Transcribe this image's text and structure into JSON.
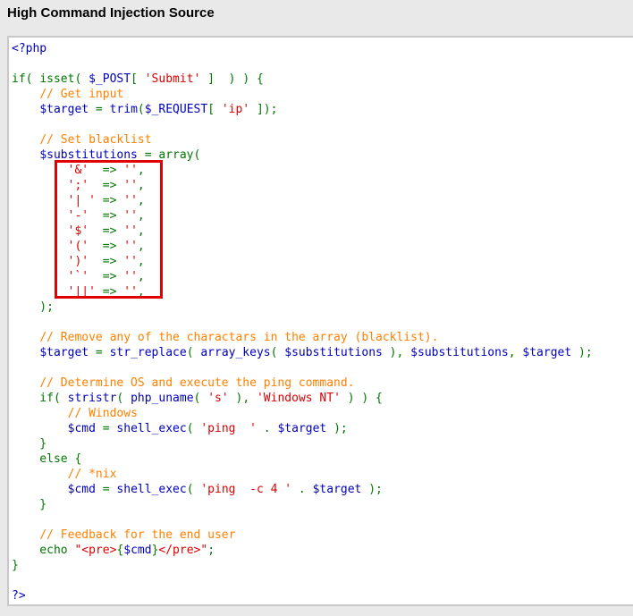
{
  "page": {
    "title": "High Command Injection Source"
  },
  "colors": {
    "keyword": "#007700",
    "variable": "#0000bb",
    "string": "#dd0000",
    "comment": "#ff8000",
    "plain": "#000000",
    "highlight_border": "#e00000",
    "panel_background": "#ffffff",
    "page_background": "#e9e9e9"
  },
  "source": {
    "lines": [
      [
        {
          "t": "<?php",
          "c": "vr"
        }
      ],
      [],
      [
        {
          "t": "if( ",
          "c": "kw"
        },
        {
          "t": "isset",
          "c": "kw"
        },
        {
          "t": "( ",
          "c": "kw"
        },
        {
          "t": "$_POST",
          "c": "vr"
        },
        {
          "t": "[ ",
          "c": "kw"
        },
        {
          "t": "'Submit'",
          "c": "st"
        },
        {
          "t": " ]  ) ) {",
          "c": "kw"
        }
      ],
      [
        {
          "t": "    ",
          "c": "tx"
        },
        {
          "t": "// Get input",
          "c": "cm"
        }
      ],
      [
        {
          "t": "    ",
          "c": "tx"
        },
        {
          "t": "$target",
          "c": "vr"
        },
        {
          "t": " = ",
          "c": "kw"
        },
        {
          "t": "trim",
          "c": "vr"
        },
        {
          "t": "(",
          "c": "kw"
        },
        {
          "t": "$_REQUEST",
          "c": "vr"
        },
        {
          "t": "[ ",
          "c": "kw"
        },
        {
          "t": "'ip'",
          "c": "st"
        },
        {
          "t": " ]);",
          "c": "kw"
        }
      ],
      [],
      [
        {
          "t": "    ",
          "c": "tx"
        },
        {
          "t": "// Set blacklist",
          "c": "cm"
        }
      ],
      [
        {
          "t": "    ",
          "c": "tx"
        },
        {
          "t": "$substitutions",
          "c": "vr"
        },
        {
          "t": " = array(",
          "c": "kw"
        }
      ],
      [
        {
          "t": "        ",
          "c": "tx"
        },
        {
          "t": "'&'",
          "c": "st"
        },
        {
          "t": "  => ",
          "c": "kw"
        },
        {
          "t": "''",
          "c": "st"
        },
        {
          "t": ",",
          "c": "kw"
        }
      ],
      [
        {
          "t": "        ",
          "c": "tx"
        },
        {
          "t": "';'",
          "c": "st"
        },
        {
          "t": "  => ",
          "c": "kw"
        },
        {
          "t": "''",
          "c": "st"
        },
        {
          "t": ",",
          "c": "kw"
        }
      ],
      [
        {
          "t": "        ",
          "c": "tx"
        },
        {
          "t": "'| '",
          "c": "st"
        },
        {
          "t": " => ",
          "c": "kw"
        },
        {
          "t": "''",
          "c": "st"
        },
        {
          "t": ",",
          "c": "kw"
        }
      ],
      [
        {
          "t": "        ",
          "c": "tx"
        },
        {
          "t": "'-'",
          "c": "st"
        },
        {
          "t": "  => ",
          "c": "kw"
        },
        {
          "t": "''",
          "c": "st"
        },
        {
          "t": ",",
          "c": "kw"
        }
      ],
      [
        {
          "t": "        ",
          "c": "tx"
        },
        {
          "t": "'$'",
          "c": "st"
        },
        {
          "t": "  => ",
          "c": "kw"
        },
        {
          "t": "''",
          "c": "st"
        },
        {
          "t": ",",
          "c": "kw"
        }
      ],
      [
        {
          "t": "        ",
          "c": "tx"
        },
        {
          "t": "'('",
          "c": "st"
        },
        {
          "t": "  => ",
          "c": "kw"
        },
        {
          "t": "''",
          "c": "st"
        },
        {
          "t": ",",
          "c": "kw"
        }
      ],
      [
        {
          "t": "        ",
          "c": "tx"
        },
        {
          "t": "')'",
          "c": "st"
        },
        {
          "t": "  => ",
          "c": "kw"
        },
        {
          "t": "''",
          "c": "st"
        },
        {
          "t": ",",
          "c": "kw"
        }
      ],
      [
        {
          "t": "        ",
          "c": "tx"
        },
        {
          "t": "'`'",
          "c": "st"
        },
        {
          "t": "  => ",
          "c": "kw"
        },
        {
          "t": "''",
          "c": "st"
        },
        {
          "t": ",",
          "c": "kw"
        }
      ],
      [
        {
          "t": "        ",
          "c": "tx"
        },
        {
          "t": "'||'",
          "c": "st"
        },
        {
          "t": " => ",
          "c": "kw"
        },
        {
          "t": "''",
          "c": "st"
        },
        {
          "t": ",",
          "c": "kw"
        }
      ],
      [
        {
          "t": "    );",
          "c": "kw"
        }
      ],
      [],
      [
        {
          "t": "    ",
          "c": "tx"
        },
        {
          "t": "// Remove any of the charactars in the array (blacklist).",
          "c": "cm"
        }
      ],
      [
        {
          "t": "    ",
          "c": "tx"
        },
        {
          "t": "$target",
          "c": "vr"
        },
        {
          "t": " = ",
          "c": "kw"
        },
        {
          "t": "str_replace",
          "c": "vr"
        },
        {
          "t": "( ",
          "c": "kw"
        },
        {
          "t": "array_keys",
          "c": "vr"
        },
        {
          "t": "( ",
          "c": "kw"
        },
        {
          "t": "$substitutions",
          "c": "vr"
        },
        {
          "t": " ), ",
          "c": "kw"
        },
        {
          "t": "$substitutions",
          "c": "vr"
        },
        {
          "t": ", ",
          "c": "kw"
        },
        {
          "t": "$target",
          "c": "vr"
        },
        {
          "t": " );",
          "c": "kw"
        }
      ],
      [],
      [
        {
          "t": "    ",
          "c": "tx"
        },
        {
          "t": "// Determine OS and execute the ping command.",
          "c": "cm"
        }
      ],
      [
        {
          "t": "    if( ",
          "c": "kw"
        },
        {
          "t": "stristr",
          "c": "vr"
        },
        {
          "t": "( ",
          "c": "kw"
        },
        {
          "t": "php_uname",
          "c": "vr"
        },
        {
          "t": "( ",
          "c": "kw"
        },
        {
          "t": "'s'",
          "c": "st"
        },
        {
          "t": " ), ",
          "c": "kw"
        },
        {
          "t": "'Windows NT'",
          "c": "st"
        },
        {
          "t": " ) ) {",
          "c": "kw"
        }
      ],
      [
        {
          "t": "        ",
          "c": "tx"
        },
        {
          "t": "// Windows",
          "c": "cm"
        }
      ],
      [
        {
          "t": "        ",
          "c": "tx"
        },
        {
          "t": "$cmd",
          "c": "vr"
        },
        {
          "t": " = ",
          "c": "kw"
        },
        {
          "t": "shell_exec",
          "c": "vr"
        },
        {
          "t": "( ",
          "c": "kw"
        },
        {
          "t": "'ping  '",
          "c": "st"
        },
        {
          "t": " . ",
          "c": "kw"
        },
        {
          "t": "$target",
          "c": "vr"
        },
        {
          "t": " );",
          "c": "kw"
        }
      ],
      [
        {
          "t": "    }",
          "c": "kw"
        }
      ],
      [
        {
          "t": "    else {",
          "c": "kw"
        }
      ],
      [
        {
          "t": "        ",
          "c": "tx"
        },
        {
          "t": "// *nix",
          "c": "cm"
        }
      ],
      [
        {
          "t": "        ",
          "c": "tx"
        },
        {
          "t": "$cmd",
          "c": "vr"
        },
        {
          "t": " = ",
          "c": "kw"
        },
        {
          "t": "shell_exec",
          "c": "vr"
        },
        {
          "t": "( ",
          "c": "kw"
        },
        {
          "t": "'ping  -c 4 '",
          "c": "st"
        },
        {
          "t": " . ",
          "c": "kw"
        },
        {
          "t": "$target",
          "c": "vr"
        },
        {
          "t": " );",
          "c": "kw"
        }
      ],
      [
        {
          "t": "    }",
          "c": "kw"
        }
      ],
      [],
      [
        {
          "t": "    ",
          "c": "tx"
        },
        {
          "t": "// Feedback for the end user",
          "c": "cm"
        }
      ],
      [
        {
          "t": "    echo ",
          "c": "kw"
        },
        {
          "t": "\"<pre>",
          "c": "st"
        },
        {
          "t": "{",
          "c": "kw"
        },
        {
          "t": "$cmd",
          "c": "vr"
        },
        {
          "t": "}",
          "c": "kw"
        },
        {
          "t": "</pre>\"",
          "c": "st"
        },
        {
          "t": ";",
          "c": "kw"
        }
      ],
      [
        {
          "t": "}",
          "c": "kw"
        }
      ],
      [],
      [
        {
          "t": "?>",
          "c": "vr"
        }
      ]
    ]
  }
}
